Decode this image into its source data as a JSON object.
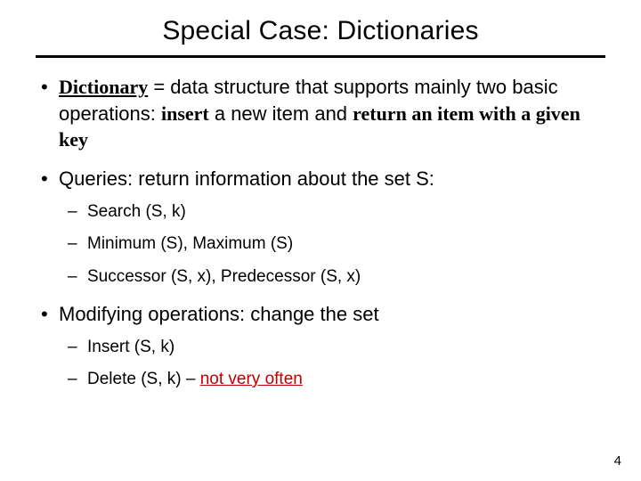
{
  "title": "Special Case: Dictionaries",
  "bullets": {
    "b1": {
      "term": "Dictionary",
      "eq": " = ",
      "def1": "data structure that supports mainly two basic operations: ",
      "insert": "insert",
      "mid": " a new item and ",
      "return": "return an item with a given key"
    },
    "b2": {
      "lead": "Queries: ",
      "rest": "return information about the set S:",
      "subs": [
        "Search (S, k)",
        "Minimum (S), Maximum (S)",
        "Successor (S, x), Predecessor (S, x)"
      ]
    },
    "b3": {
      "lead": "Modifying operations: ",
      "rest": "change the set",
      "subs": {
        "s1": "Insert (S, k)",
        "s2_a": "Delete (S, k) – ",
        "s2_b": "not very often"
      }
    }
  },
  "page_number": "4"
}
